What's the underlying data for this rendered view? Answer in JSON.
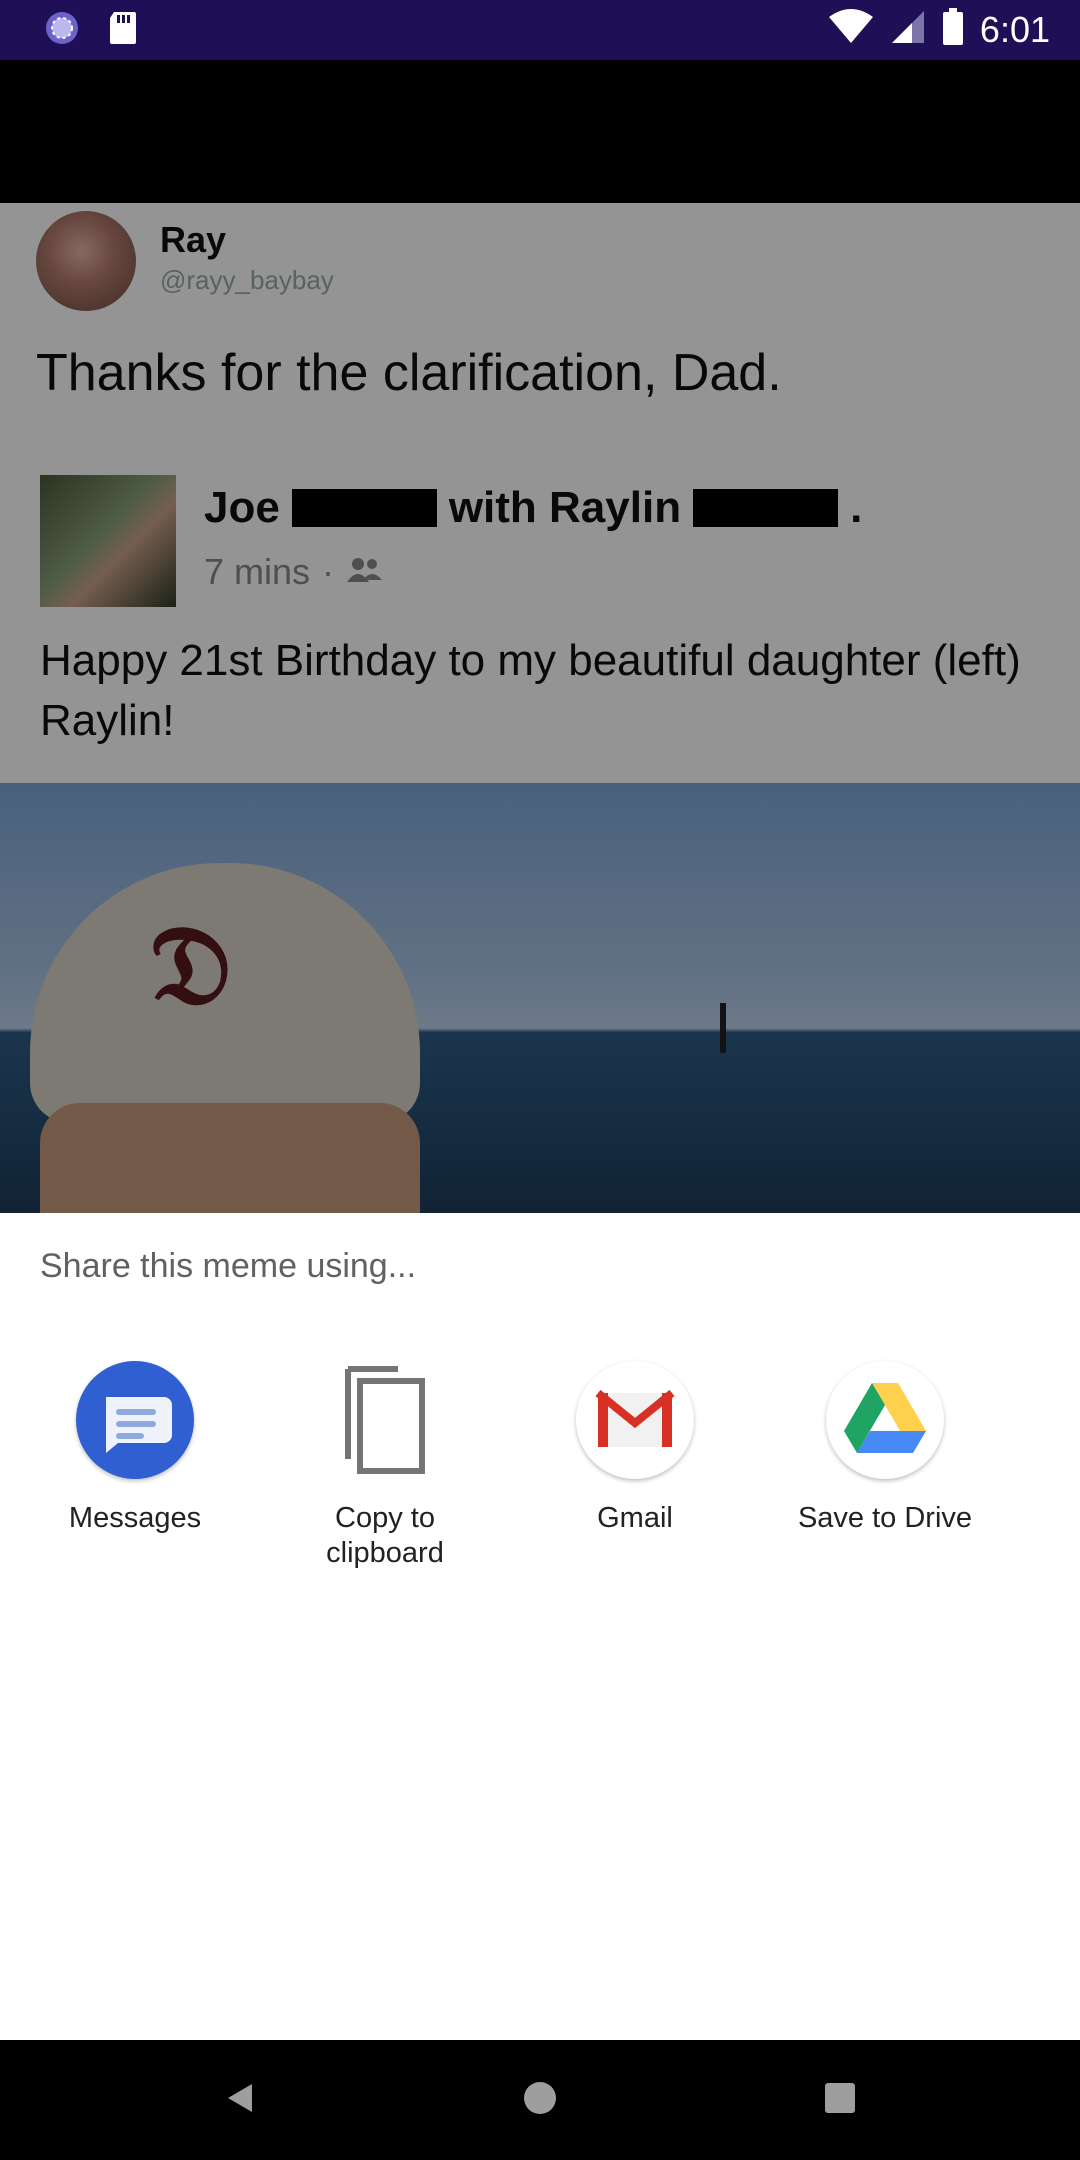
{
  "status_bar": {
    "time": "6:01",
    "icons": [
      "app-notification-icon",
      "sd-card-icon",
      "wifi-icon",
      "signal-icon",
      "battery-icon"
    ]
  },
  "meme": {
    "author_name": "Ray",
    "author_handle": "@rayy_baybay",
    "tweet_text": "Thanks for the clarification, Dad.",
    "fb_post": {
      "name_prefix": "Joe",
      "with_text": "with Raylin",
      "period": ".",
      "time": "7 mins",
      "separator": "·",
      "body": "Happy 21st Birthday to my beautiful daughter (left) Raylin!"
    }
  },
  "share_sheet": {
    "title": "Share this meme using...",
    "targets": [
      {
        "label": "Messages",
        "icon": "messages-icon"
      },
      {
        "label": "Copy to clipboard",
        "icon": "copy-icon"
      },
      {
        "label": "Gmail",
        "icon": "gmail-icon"
      },
      {
        "label": "Save to Drive",
        "icon": "drive-icon"
      }
    ]
  },
  "nav_bar": {
    "buttons": [
      "back",
      "home",
      "recents"
    ]
  },
  "colors": {
    "status_bar": "#1e0f57",
    "messages_blue": "#2f5fd0",
    "gmail_red": "#d93025",
    "drive_green": "#1fa463",
    "drive_yellow": "#ffd04b",
    "drive_blue": "#4688f4"
  }
}
